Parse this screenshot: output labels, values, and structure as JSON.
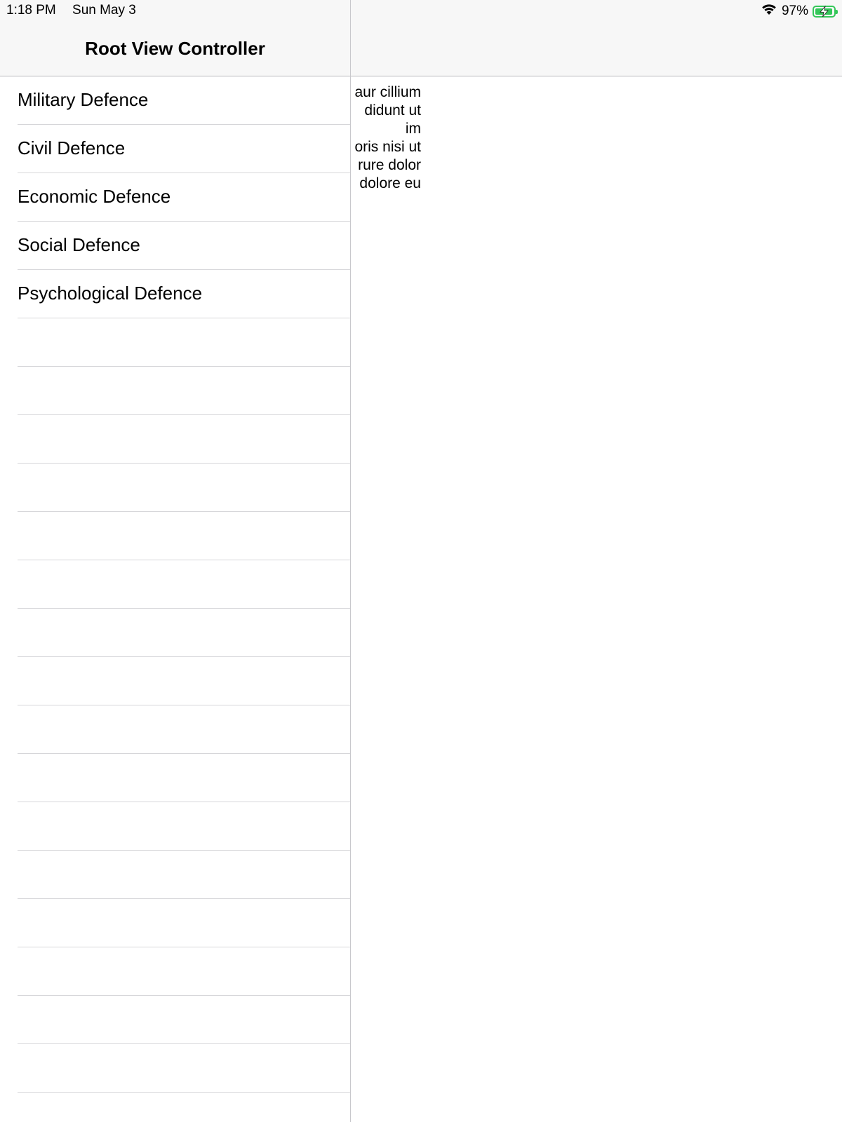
{
  "status_bar": {
    "time": "1:18 PM",
    "date": "Sun May 3",
    "wifi_icon": "wifi-icon",
    "battery_percent": "97%",
    "battery_level": 0.97,
    "battery_icon": "battery-charging-icon",
    "battery_color": "#34c759"
  },
  "master": {
    "title": "Root View Controller",
    "items": [
      {
        "label": "Military Defence"
      },
      {
        "label": "Civil Defence"
      },
      {
        "label": "Economic Defence"
      },
      {
        "label": "Social Defence"
      },
      {
        "label": "Psychological Defence"
      }
    ]
  },
  "detail": {
    "text_lines": [
      "aur cillium",
      "didunt ut",
      "im",
      "oris nisi ut",
      "rure dolor",
      "dolore eu"
    ]
  },
  "colors": {
    "nav_background": "#f7f7f7",
    "separator": "#d6d6d9",
    "divider": "#c8c8cc"
  }
}
